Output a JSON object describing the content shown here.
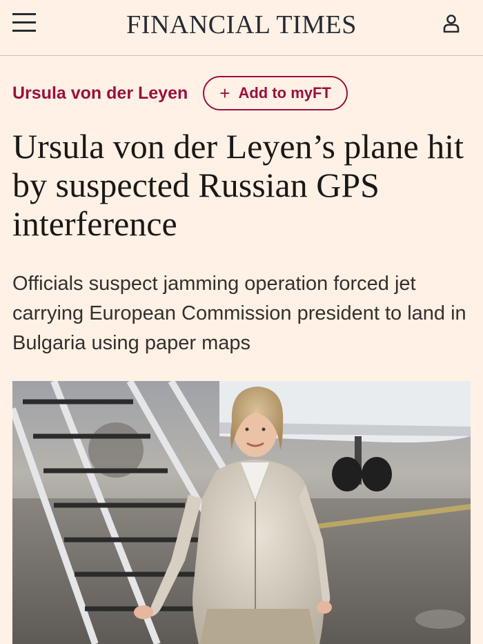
{
  "header": {
    "brand": "FINANCIAL TIMES",
    "menu_icon": "hamburger-menu-icon",
    "account_icon": "user-icon"
  },
  "topic": {
    "label": "Ursula von der Leyen",
    "follow_button": {
      "icon": "plus-icon",
      "label": "Add to myFT"
    }
  },
  "article": {
    "headline": "Ursula von der Leyen’s plane hit by suspected Russian GPS interference",
    "standfirst": "Officials suspect jamming operation forced jet carrying European Commission president to land in Bulgaria using paper maps"
  },
  "colors": {
    "background": "#fff1e5",
    "accent": "#990f3d",
    "text": "#1a1817"
  }
}
